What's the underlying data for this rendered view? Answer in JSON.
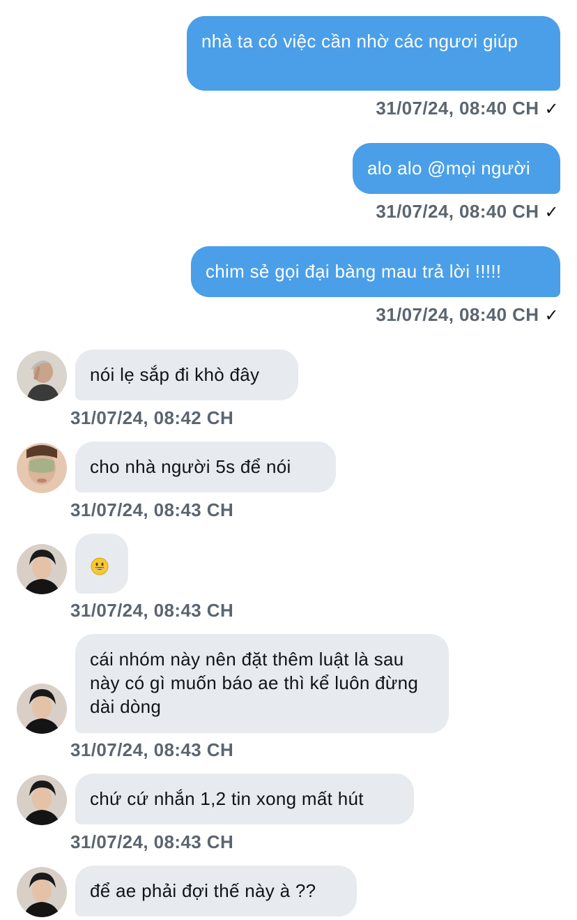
{
  "outgoing": [
    {
      "text": "nhà ta có việc cần nhờ các ngươi giúp",
      "time": "31/07/24, 08:40 CH"
    },
    {
      "text": "alo alo @mọi người",
      "time": "31/07/24, 08:40 CH"
    },
    {
      "text": "chim sẻ gọi đại bàng mau trả lời !!!!!",
      "time": "31/07/24, 08:40 CH"
    }
  ],
  "read_mark": "✓",
  "incoming": [
    {
      "text": "nói lẹ sắp đi khò đây",
      "time": "31/07/24, 08:42 CH"
    },
    {
      "text": "cho nhà người 5s để nói",
      "time": "31/07/24, 08:43 CH"
    },
    {
      "emoji": "grinning-face-emoji",
      "time": "31/07/24, 08:43 CH"
    },
    {
      "text": "cái nhóm này nên đặt thêm luật là sau này có gì muốn báo ae thì kể luôn đừng dài dòng",
      "time": "31/07/24, 08:43 CH"
    },
    {
      "text": "chứ cứ nhắn 1,2 tin xong mất hút",
      "time": "31/07/24, 08:43 CH"
    },
    {
      "text": "để ae phải đợi thế này à ??"
    }
  ],
  "colors": {
    "outgoing_bubble": "#4a9fe8",
    "incoming_bubble": "#e7ebef",
    "timestamp": "#5b6570"
  }
}
